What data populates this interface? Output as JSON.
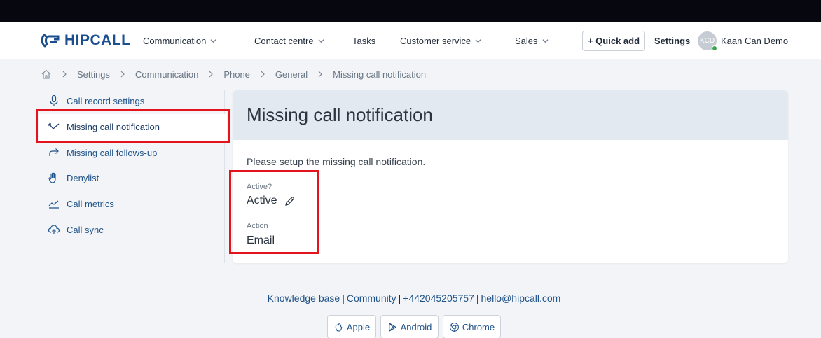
{
  "brand": {
    "name": "HIPCALL",
    "color": "#1b4f8f"
  },
  "header": {
    "nav": [
      {
        "label": "Communication",
        "has_dropdown": true
      },
      {
        "label": "Contact centre",
        "has_dropdown": true
      },
      {
        "label": "Tasks",
        "has_dropdown": false
      },
      {
        "label": "Customer service",
        "has_dropdown": true
      },
      {
        "label": "Sales",
        "has_dropdown": true
      }
    ],
    "quick_add_label": "+ Quick add",
    "settings_label": "Settings",
    "user": {
      "initials": "KCD",
      "name": "Kaan Can Demo",
      "status_color": "#3aa64b"
    }
  },
  "breadcrumb": {
    "home_icon": "home-icon",
    "items": [
      "Settings",
      "Communication",
      "Phone",
      "General",
      "Missing call notification"
    ]
  },
  "sidebar": {
    "items": [
      {
        "label": "Call record settings",
        "icon": "microphone-icon"
      },
      {
        "label": "Missing call notification",
        "icon": "missed-call-icon",
        "active": true
      },
      {
        "label": "Missing call follows-up",
        "icon": "forward-arrow-icon"
      },
      {
        "label": "Denylist",
        "icon": "hand-icon"
      },
      {
        "label": "Call metrics",
        "icon": "line-chart-icon"
      },
      {
        "label": "Call sync",
        "icon": "cloud-upload-icon"
      }
    ]
  },
  "main": {
    "title": "Missing call notification",
    "description": "Please setup the missing call notification.",
    "fields": [
      {
        "label": "Active?",
        "value": "Active",
        "editable": true
      },
      {
        "label": "Action",
        "value": "Email",
        "editable": false
      }
    ]
  },
  "footer": {
    "links": [
      "Knowledge base",
      "Community",
      "+442045205757",
      "hello@hipcall.com"
    ],
    "apps": [
      {
        "label": "Apple",
        "icon": "apple-icon"
      },
      {
        "label": "Android",
        "icon": "android-icon"
      },
      {
        "label": "Chrome",
        "icon": "chrome-icon"
      }
    ]
  },
  "colors": {
    "highlight": "#e5141c",
    "link": "#1f5289",
    "card_header": "#e3e9f0"
  }
}
